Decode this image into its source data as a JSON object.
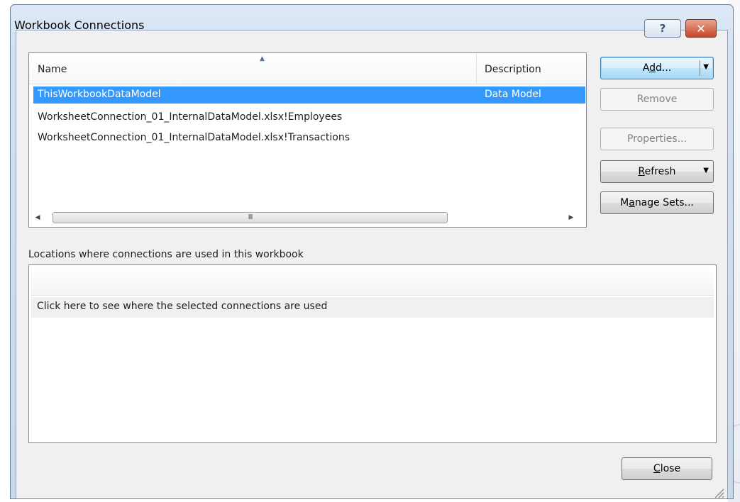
{
  "window": {
    "title": "Workbook Connections",
    "help_glyph": "?",
    "close_glyph": "✕"
  },
  "connections": {
    "columns": {
      "name": "Name",
      "description": "Description"
    },
    "rows": [
      {
        "name": "ThisWorkbookDataModel",
        "description": "Data Model",
        "selected": true
      },
      {
        "name": "WorksheetConnection_01_InternalDataModel.xlsx!Employees",
        "description": ""
      },
      {
        "name": "WorksheetConnection_01_InternalDataModel.xlsx!Transactions",
        "description": ""
      }
    ],
    "scroll_left_glyph": "◀",
    "scroll_right_glyph": "▶",
    "scroll_grip_glyph": "III",
    "sort_glyph": "▲"
  },
  "buttons": {
    "add": {
      "pre": "A",
      "accel": "d",
      "post": "d...",
      "dropdown": "▼"
    },
    "remove": "Remove",
    "properties": "Properties...",
    "refresh": {
      "pre": "",
      "accel": "R",
      "post": "efresh",
      "dropdown": "▼"
    },
    "manage_sets": {
      "pre": "M",
      "accel": "a",
      "post": "nage Sets..."
    },
    "close": {
      "pre": "",
      "accel": "C",
      "post": "lose"
    }
  },
  "locations": {
    "label": "Locations where connections are used in this workbook",
    "hint": "Click here to see where the selected connections are used"
  },
  "colors": {
    "selection": "#3399ff",
    "dialog_bg": "#f0f0f0",
    "frame": "#d4e2f2"
  }
}
